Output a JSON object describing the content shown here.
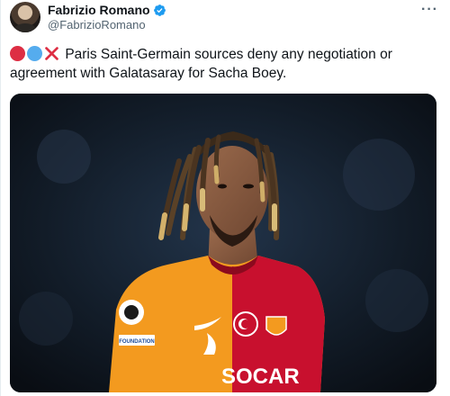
{
  "tweet": {
    "author": {
      "display_name": "Fabrizio Romano",
      "handle": "@FabrizioRomano"
    },
    "more_icon": "ellipsis-icon",
    "text": "Paris Saint-Germain sources deny any negotiation or agreement with Galatasaray for Sacha Boey.",
    "emojis": [
      "red-circle",
      "blue-circle",
      "cross-mark"
    ],
    "media": {
      "kind": "photo",
      "jersey_sponsor": "SOCAR",
      "sleeve_patch": "FOUNDATION"
    }
  },
  "colors": {
    "verified": "#1d9bf0",
    "text": "#0f1419",
    "secondary": "#536471",
    "red_emoji": "#dd2e44",
    "blue_emoji": "#55acee",
    "jersey_red": "#c8102e",
    "jersey_orange": "#f39a1f"
  }
}
